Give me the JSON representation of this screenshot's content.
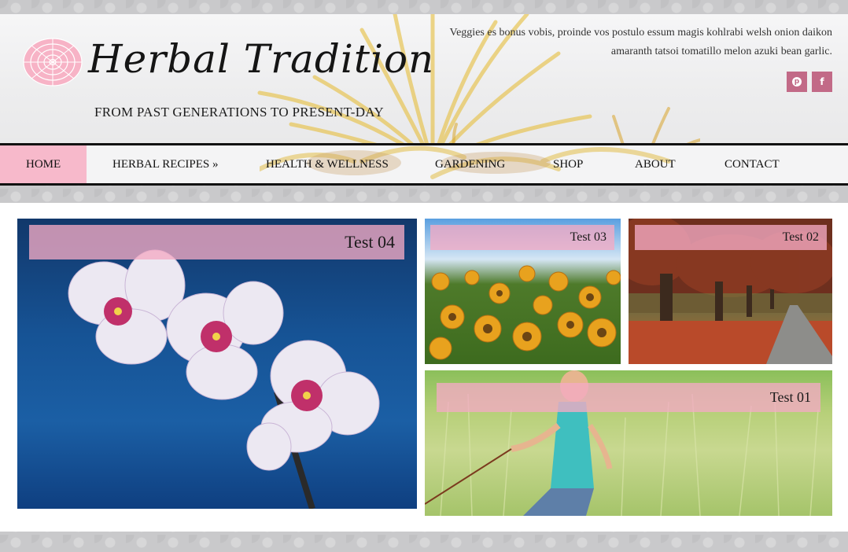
{
  "header": {
    "site_title": "Herbal Tradition",
    "tagline": "FROM PAST GENERATIONS TO PRESENT-DAY",
    "blurb": "Veggies es bonus vobis, proinde vos postulo essum magis kohlrabi welsh onion daikon amaranth tatsoi tomatillo melon azuki bean garlic.",
    "social": [
      {
        "icon": "pinterest-icon",
        "glyph": "p"
      },
      {
        "icon": "facebook-icon",
        "glyph": "f"
      }
    ]
  },
  "nav": {
    "items": [
      {
        "label": "HOME",
        "active": true
      },
      {
        "label": "HERBAL RECIPES »"
      },
      {
        "label": "HEALTH & WELLNESS"
      },
      {
        "label": "GARDENING"
      },
      {
        "label": "SHOP"
      },
      {
        "label": "ABOUT"
      },
      {
        "label": "CONTACT"
      }
    ]
  },
  "featured": {
    "tiles": [
      {
        "title": "Test 04",
        "image": "orchid"
      },
      {
        "title": "Test 03",
        "image": "yellow-flowers"
      },
      {
        "title": "Test 02",
        "image": "autumn-trees"
      },
      {
        "title": "Test 01",
        "image": "woman-in-field"
      }
    ]
  },
  "colors": {
    "accent_pink": "#f7b9cb",
    "social_button": "#c26a87",
    "nav_border": "#111111"
  }
}
